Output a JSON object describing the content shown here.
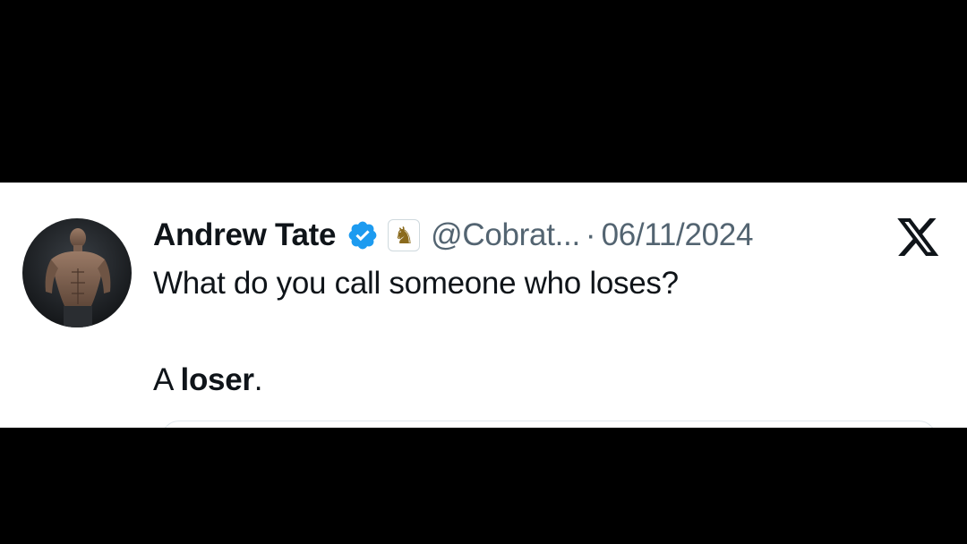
{
  "tweet": {
    "author": {
      "display_name": "Andrew Tate",
      "handle": "@Cobrat...",
      "verified": true,
      "verified_icon": "verified-badge-icon",
      "affiliate_icon": "chess-knight-icon",
      "avatar_icon": "profile-photo"
    },
    "separator": "·",
    "date": "06/11/2024",
    "text_line1": "What do you call someone who loses?",
    "text_line2_prefix": "A ",
    "text_line2_bold": "loser",
    "text_line2_suffix": ".",
    "platform_icon": "x-logo-icon"
  },
  "colors": {
    "background_bars": "#000000",
    "card_background": "#ffffff",
    "primary_text": "#0f1419",
    "secondary_text": "#536471",
    "verified_blue": "#1d9bf0"
  }
}
